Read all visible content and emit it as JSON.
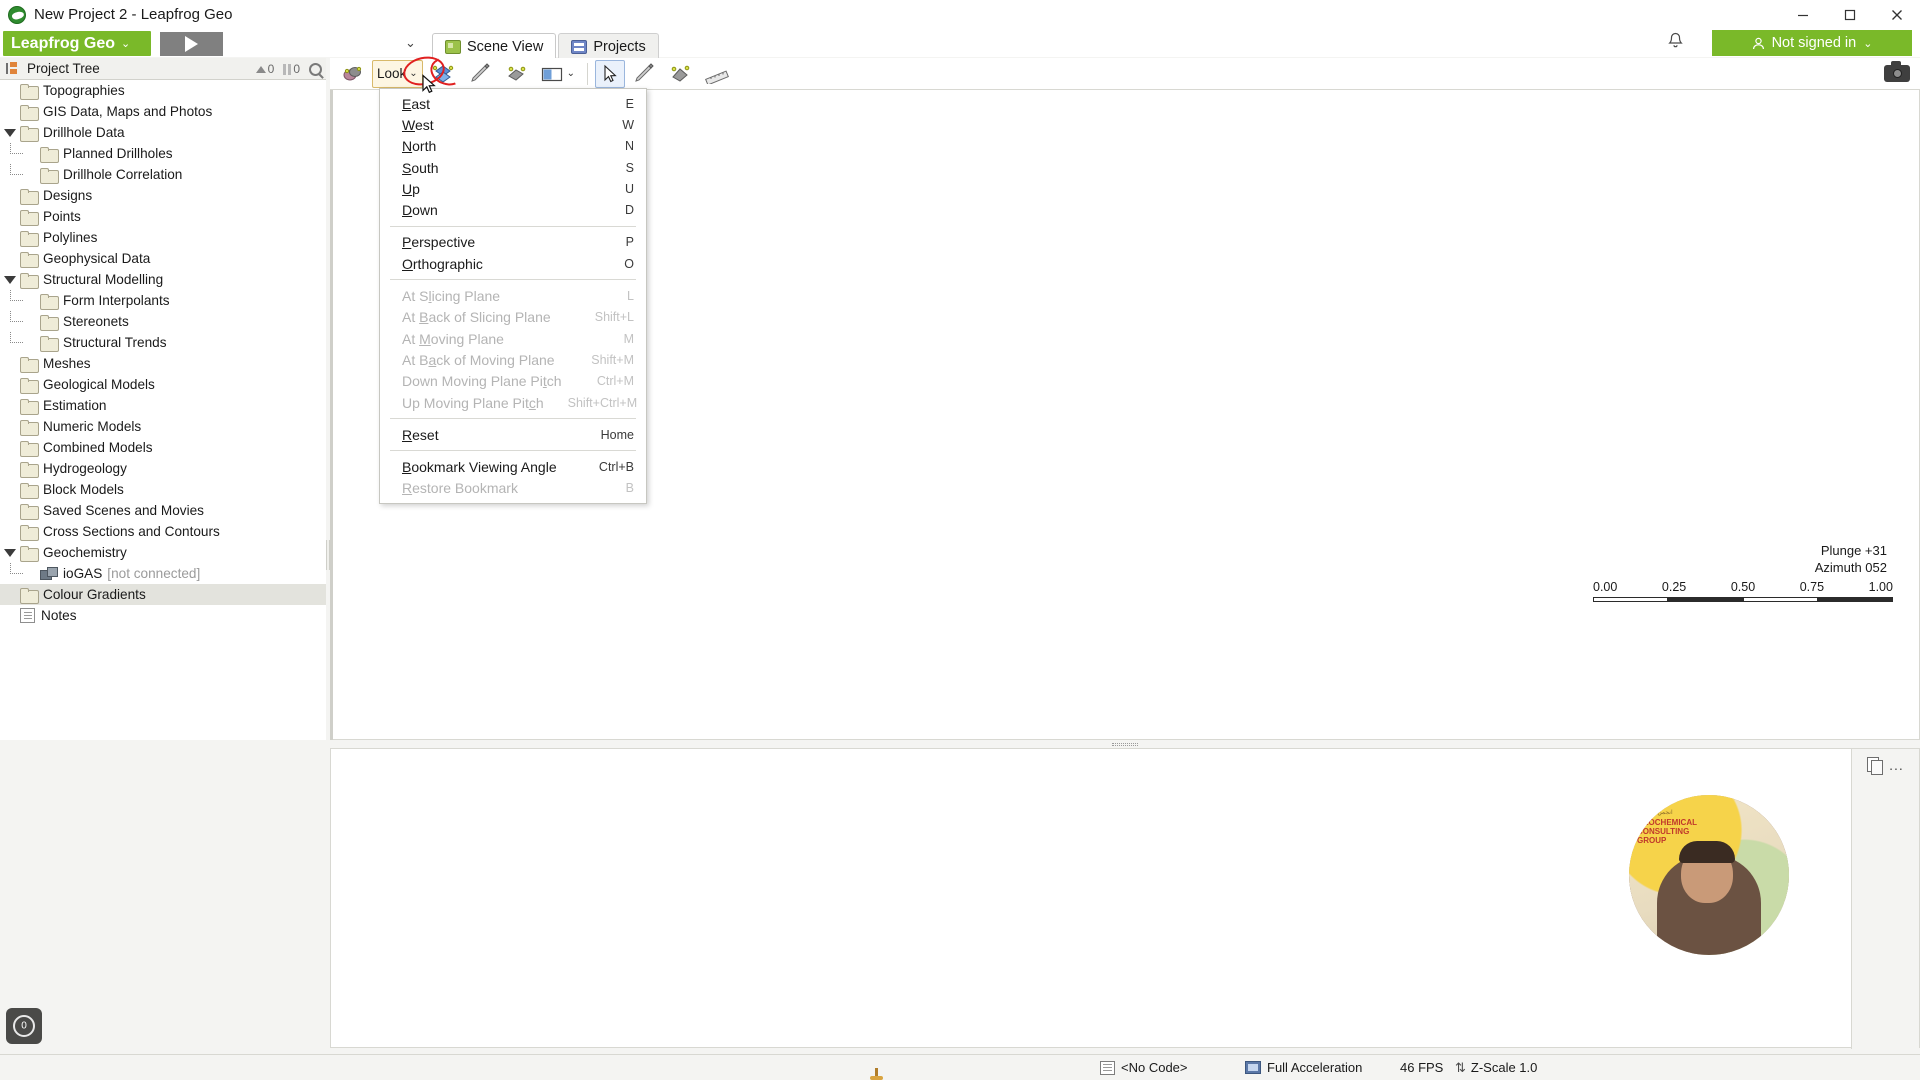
{
  "window": {
    "title": "New Project 2 - Leapfrog Geo",
    "app_icon": "leapfrog-logo-icon",
    "minimize": "minimize-icon",
    "maximize": "maximize-icon",
    "close": "close-icon"
  },
  "brand": {
    "name": "Leapfrog Geo",
    "chevron": "⌄",
    "play_icon": "play-icon",
    "dropdown_chevron": "⌄"
  },
  "header": {
    "bell_icon": "notification-bell-icon",
    "sign_in_label": "Not signed in",
    "sign_in_user_icon": "user-icon",
    "sign_in_chevron": "⌄"
  },
  "tabs": [
    {
      "label": "Scene View",
      "icon": "scene-view-icon",
      "active": true
    },
    {
      "label": "Projects",
      "icon": "projects-icon",
      "active": false
    }
  ],
  "project_tree": {
    "header_title": "Project Tree",
    "header_icon": "project-tree-icon",
    "counters": [
      {
        "icon": "up-arrow-icon",
        "value": "0"
      },
      {
        "icon": "pause-icon",
        "value": "0"
      }
    ],
    "search_icon": "magnifier-icon",
    "items": [
      {
        "label": "Topographies",
        "depth": 0,
        "icon": "folder-icon",
        "twisty": "none"
      },
      {
        "label": "GIS Data, Maps and Photos",
        "depth": 0,
        "icon": "folder-icon",
        "twisty": "none"
      },
      {
        "label": "Drillhole Data",
        "depth": 0,
        "icon": "folder-icon",
        "twisty": "expanded"
      },
      {
        "label": "Planned Drillholes",
        "depth": 1,
        "icon": "folder-icon",
        "twisty": "none"
      },
      {
        "label": "Drillhole Correlation",
        "depth": 1,
        "icon": "folder-icon",
        "twisty": "none",
        "last_child": true
      },
      {
        "label": "Designs",
        "depth": 0,
        "icon": "folder-icon",
        "twisty": "none"
      },
      {
        "label": "Points",
        "depth": 0,
        "icon": "folder-icon",
        "twisty": "none"
      },
      {
        "label": "Polylines",
        "depth": 0,
        "icon": "folder-icon",
        "twisty": "none"
      },
      {
        "label": "Geophysical Data",
        "depth": 0,
        "icon": "folder-icon",
        "twisty": "none"
      },
      {
        "label": "Structural Modelling",
        "depth": 0,
        "icon": "folder-icon",
        "twisty": "expanded"
      },
      {
        "label": "Form Interpolants",
        "depth": 1,
        "icon": "folder-icon",
        "twisty": "none"
      },
      {
        "label": "Stereonets",
        "depth": 1,
        "icon": "folder-icon",
        "twisty": "none"
      },
      {
        "label": "Structural Trends",
        "depth": 1,
        "icon": "folder-icon",
        "twisty": "none",
        "last_child": true
      },
      {
        "label": "Meshes",
        "depth": 0,
        "icon": "folder-icon",
        "twisty": "none"
      },
      {
        "label": "Geological Models",
        "depth": 0,
        "icon": "folder-icon",
        "twisty": "none"
      },
      {
        "label": "Estimation",
        "depth": 0,
        "icon": "folder-icon",
        "twisty": "none"
      },
      {
        "label": "Numeric Models",
        "depth": 0,
        "icon": "folder-icon",
        "twisty": "none"
      },
      {
        "label": "Combined Models",
        "depth": 0,
        "icon": "folder-icon",
        "twisty": "none"
      },
      {
        "label": "Hydrogeology",
        "depth": 0,
        "icon": "folder-icon",
        "twisty": "none"
      },
      {
        "label": "Block Models",
        "depth": 0,
        "icon": "folder-icon",
        "twisty": "none"
      },
      {
        "label": "Saved Scenes and Movies",
        "depth": 0,
        "icon": "folder-icon",
        "twisty": "none"
      },
      {
        "label": "Cross Sections and Contours",
        "depth": 0,
        "icon": "folder-icon",
        "twisty": "none"
      },
      {
        "label": "Geochemistry",
        "depth": 0,
        "icon": "folder-icon",
        "twisty": "expanded"
      },
      {
        "label": "ioGAS",
        "suffix": "[not connected]",
        "depth": 1,
        "icon": "iogas-icon",
        "twisty": "none",
        "last_child": true
      },
      {
        "label": "Colour Gradients",
        "depth": 0,
        "icon": "folder-icon",
        "twisty": "none",
        "selected": true
      },
      {
        "label": "Notes",
        "depth": 0,
        "icon": "note-icon",
        "twisty": "none"
      }
    ]
  },
  "toolbar": {
    "buttons": [
      {
        "name": "move-to-scene-button",
        "icon": "scene-objects-icon",
        "label": ""
      },
      {
        "name": "look-button",
        "label": "Look",
        "icon": "look-icon",
        "chevron": "⌄",
        "pressed": true
      },
      {
        "name": "rotate-button",
        "icon": "rotate-icon",
        "label": ""
      },
      {
        "name": "measure-pen-button",
        "icon": "pen-icon",
        "label": ""
      },
      {
        "name": "clip-button",
        "icon": "clipping-icon",
        "label": ""
      },
      {
        "name": "view-mode-button",
        "icon": "view-rect-icon",
        "label": "",
        "chevron": "⌄"
      },
      {
        "name": "select-tool-button",
        "icon": "cursor-arrow-icon",
        "label": "",
        "selected": true
      },
      {
        "name": "draw-tool-button",
        "icon": "pencil-icon",
        "label": ""
      },
      {
        "name": "polyline-tool-button",
        "icon": "polyline-icon",
        "label": ""
      },
      {
        "name": "ruler-tool-button",
        "icon": "ruler-icon",
        "label": ""
      }
    ],
    "camera_button": {
      "name": "screenshot-button",
      "icon": "camera-icon"
    }
  },
  "look_menu": {
    "open": true,
    "groups": [
      [
        {
          "label": "East",
          "mnemonic": "E",
          "shortcut": "E",
          "disabled": false
        },
        {
          "label": "West",
          "mnemonic": "W",
          "shortcut": "W",
          "disabled": false
        },
        {
          "label": "North",
          "mnemonic": "N",
          "shortcut": "N",
          "disabled": false
        },
        {
          "label": "South",
          "mnemonic": "S",
          "shortcut": "S",
          "disabled": false
        },
        {
          "label": "Up",
          "mnemonic": "U",
          "shortcut": "U",
          "disabled": false
        },
        {
          "label": "Down",
          "mnemonic": "D",
          "shortcut": "D",
          "disabled": false
        }
      ],
      [
        {
          "label": "Perspective",
          "mnemonic": "P",
          "shortcut": "P",
          "disabled": false
        },
        {
          "label": "Orthographic",
          "mnemonic": "O",
          "shortcut": "O",
          "disabled": false
        }
      ],
      [
        {
          "label": "At Slicing Plane",
          "mnemonic": "l",
          "shortcut": "L",
          "disabled": true
        },
        {
          "label": "At Back of Slicing Plane",
          "mnemonic": "B",
          "shortcut": "Shift+L",
          "disabled": true
        },
        {
          "label": "At Moving Plane",
          "mnemonic": "M",
          "shortcut": "M",
          "disabled": true
        },
        {
          "label": "At Back of Moving Plane",
          "mnemonic": "a",
          "shortcut": "Shift+M",
          "disabled": true
        },
        {
          "label": "Down Moving Plane Pitch",
          "mnemonic": "t",
          "shortcut": "Ctrl+M",
          "disabled": true
        },
        {
          "label": "Up Moving Plane Pitch",
          "mnemonic": "c",
          "shortcut": "Shift+Ctrl+M",
          "disabled": true
        }
      ],
      [
        {
          "label": "Reset",
          "mnemonic": "R",
          "shortcut": "Home",
          "disabled": false
        }
      ],
      [
        {
          "label": "Bookmark Viewing Angle",
          "mnemonic": "B",
          "shortcut": "Ctrl+B",
          "disabled": false
        },
        {
          "label": "Restore Bookmark",
          "mnemonic": "R",
          "shortcut": "B",
          "disabled": true
        }
      ]
    ]
  },
  "scene": {
    "plunge": "Plunge  +31",
    "azimuth": "Azimuth 052",
    "scale_labels": [
      "0.00",
      "0.25",
      "0.50",
      "0.75",
      "1.00"
    ]
  },
  "bottom_panel": {
    "copy_icon": "copy-icon",
    "more_label": "...",
    "webcam": {
      "logo_lines": [
        "GEOCHEMICAL",
        "CONSULTING",
        "GROUP"
      ],
      "logo_small": "انجمن شناسی"
    }
  },
  "status_bar": {
    "centre_icon": "centre-pin-icon",
    "code": "<No Code>",
    "code_icon": "code-icon",
    "acceleration": "Full Acceleration",
    "acceleration_icon": "gpu-icon",
    "fps": "46 FPS",
    "z_scale": "Z-Scale 1.0",
    "z_scale_icon": "z-scale-icon"
  },
  "rotate_widget": {
    "value": "0",
    "icon": "compass-icon"
  },
  "colors": {
    "brand_green": "#7ab929",
    "selection": "#e3e3dd",
    "toolbar_pressed": "#fdf6e3",
    "annotation_red": "#e02020"
  }
}
